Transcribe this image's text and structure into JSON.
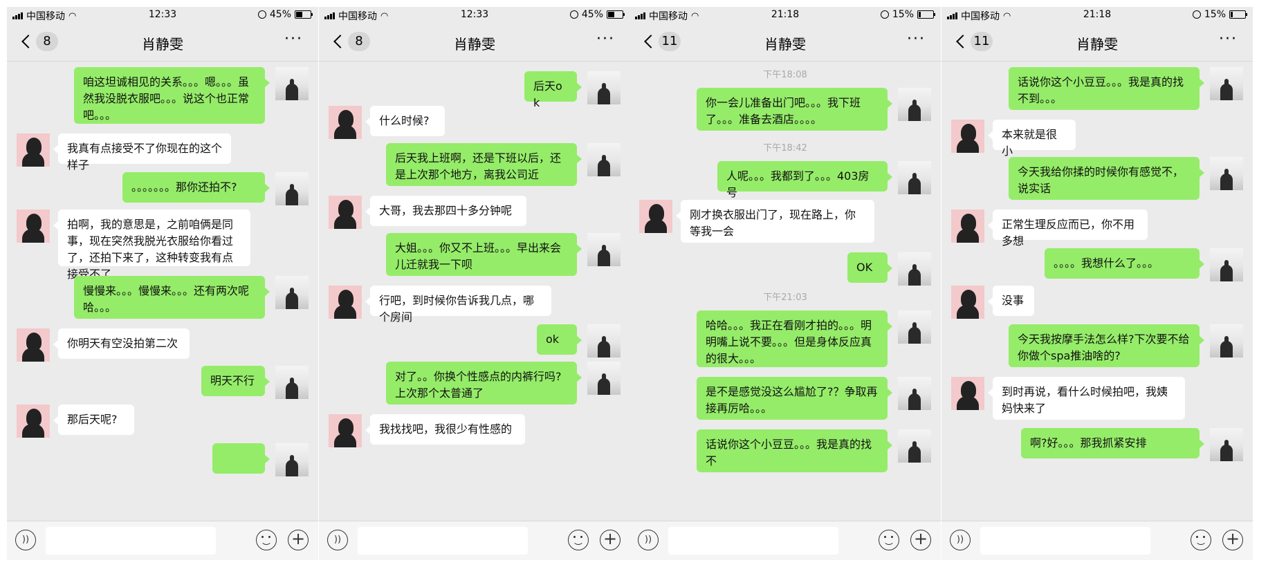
{
  "panels": [
    {
      "status": {
        "carrier": "中国移动",
        "time": "12:33",
        "battery": "45%",
        "battery_level": 0.45
      },
      "nav": {
        "badge": "8",
        "title": "肖静雯",
        "more": "···"
      },
      "messages": [
        {
          "from": "me",
          "text": "咱这坦诚相见的关系。。。嗯。。。虽然我没脱衣服吧。。。说这个也正常吧。。。"
        },
        {
          "from": "her",
          "text": "我真有点接受不了你现在的这个样子"
        },
        {
          "from": "me",
          "text": "。。。。。。。那你还拍不?"
        },
        {
          "from": "her",
          "text": "拍啊，我的意思是，之前咱俩是同事，现在突然我脱光衣服给你看过了，还拍下来了，这种转变我有点接受不了"
        },
        {
          "from": "me",
          "text": "慢慢来。。。慢慢来。。。还有两次呢哈。。。"
        },
        {
          "from": "her",
          "text": "你明天有空没拍第二次"
        },
        {
          "from": "me",
          "text": "明天不行"
        },
        {
          "from": "her",
          "text": "那后天呢?"
        },
        {
          "from": "me",
          "text": ""
        }
      ]
    },
    {
      "status": {
        "carrier": "中国移动",
        "time": "12:33",
        "battery": "45%",
        "battery_level": 0.45
      },
      "nav": {
        "badge": "8",
        "title": "肖静雯",
        "more": "···"
      },
      "messages": [
        {
          "from": "me",
          "text": "后天ok"
        },
        {
          "from": "her",
          "text": "什么时候?"
        },
        {
          "from": "me",
          "text": "后天我上班啊，还是下班以后，还是上次那个地方，离我公司近"
        },
        {
          "from": "her",
          "text": "大哥，我去那四十多分钟呢"
        },
        {
          "from": "me",
          "text": "大姐。。。你又不上班。。。早出来会儿迁就我一下呗"
        },
        {
          "from": "her",
          "text": "行吧，到时候你告诉我几点，哪个房间"
        },
        {
          "from": "me",
          "text": "ok"
        },
        {
          "from": "me",
          "text": "对了。。你换个性感点的内裤行吗?上次那个太普通了"
        },
        {
          "from": "her",
          "text": "我找找吧，我很少有性感的"
        }
      ]
    },
    {
      "status": {
        "carrier": "中国移动",
        "time": "21:18",
        "battery": "15%",
        "battery_level": 0.15
      },
      "nav": {
        "badge": "11",
        "title": "肖静雯",
        "more": "···"
      },
      "messages": [
        {
          "from": "time",
          "text": "下午18:08"
        },
        {
          "from": "me",
          "text": "你一会儿准备出门吧。。。我下班了。。。准备去酒店。。。。"
        },
        {
          "from": "time",
          "text": "下午18:42"
        },
        {
          "from": "me",
          "text": "人呢。。。我都到了。。。403房号"
        },
        {
          "from": "her",
          "text": "刚才换衣服出门了，现在路上，你等我一会"
        },
        {
          "from": "me",
          "text": "OK"
        },
        {
          "from": "time",
          "text": "下午21:03"
        },
        {
          "from": "me",
          "text": "哈哈。。。我正在看刚才拍的。。。明明嘴上说不要。。。但是身体反应真的很大。。。"
        },
        {
          "from": "me",
          "text": "是不是感觉没这么尴尬了?？争取再接再厉哈。。。"
        },
        {
          "from": "me",
          "text": "话说你这个小豆豆。。。我是真的找不"
        }
      ]
    },
    {
      "status": {
        "carrier": "中国移动",
        "time": "21:18",
        "battery": "15%",
        "battery_level": 0.15
      },
      "nav": {
        "badge": "11",
        "title": "肖静雯",
        "more": "···"
      },
      "messages": [
        {
          "from": "me",
          "text": "话说你这个小豆豆。。。我是真的找不到。。。"
        },
        {
          "from": "her",
          "text": "本来就是很小"
        },
        {
          "from": "me",
          "text": "今天我给你揉的时候你有感觉不，说实话"
        },
        {
          "from": "her",
          "text": "正常生理反应而已，你不用多想"
        },
        {
          "from": "me",
          "text": "。。。。我想什么了。。。"
        },
        {
          "from": "her",
          "text": "没事"
        },
        {
          "from": "me",
          "text": "今天我按摩手法怎么样?下次要不给你做个spa推油啥的?"
        },
        {
          "from": "her",
          "text": "到时再说，看什么时候拍吧，我姨妈快来了"
        },
        {
          "from": "me",
          "text": "啊?好。。。那我抓紧安排"
        }
      ]
    }
  ]
}
